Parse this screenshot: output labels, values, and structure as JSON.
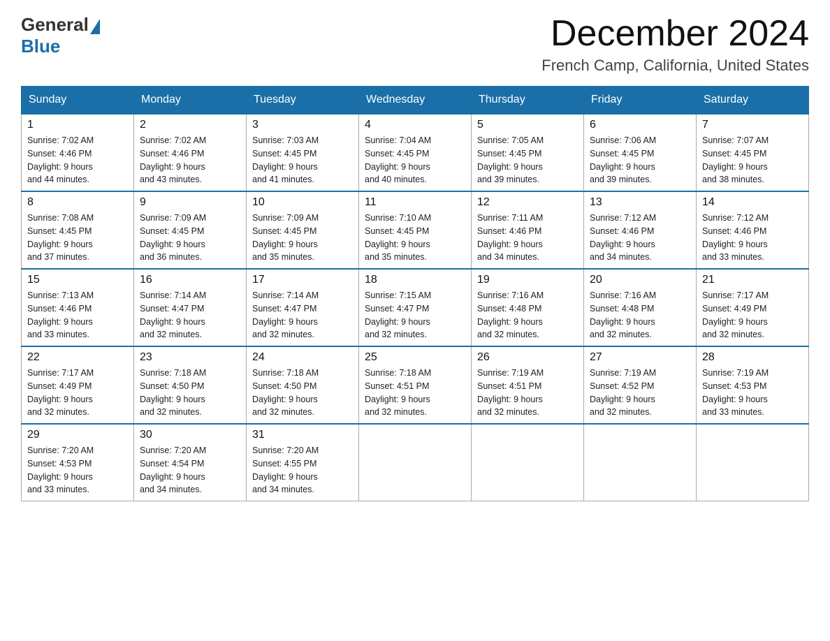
{
  "logo": {
    "general": "General",
    "blue": "Blue"
  },
  "header": {
    "month": "December 2024",
    "location": "French Camp, California, United States"
  },
  "weekdays": [
    "Sunday",
    "Monday",
    "Tuesday",
    "Wednesday",
    "Thursday",
    "Friday",
    "Saturday"
  ],
  "weeks": [
    [
      {
        "day": "1",
        "sunrise": "7:02 AM",
        "sunset": "4:46 PM",
        "daylight": "9 hours and 44 minutes."
      },
      {
        "day": "2",
        "sunrise": "7:02 AM",
        "sunset": "4:46 PM",
        "daylight": "9 hours and 43 minutes."
      },
      {
        "day": "3",
        "sunrise": "7:03 AM",
        "sunset": "4:45 PM",
        "daylight": "9 hours and 41 minutes."
      },
      {
        "day": "4",
        "sunrise": "7:04 AM",
        "sunset": "4:45 PM",
        "daylight": "9 hours and 40 minutes."
      },
      {
        "day": "5",
        "sunrise": "7:05 AM",
        "sunset": "4:45 PM",
        "daylight": "9 hours and 39 minutes."
      },
      {
        "day": "6",
        "sunrise": "7:06 AM",
        "sunset": "4:45 PM",
        "daylight": "9 hours and 39 minutes."
      },
      {
        "day": "7",
        "sunrise": "7:07 AM",
        "sunset": "4:45 PM",
        "daylight": "9 hours and 38 minutes."
      }
    ],
    [
      {
        "day": "8",
        "sunrise": "7:08 AM",
        "sunset": "4:45 PM",
        "daylight": "9 hours and 37 minutes."
      },
      {
        "day": "9",
        "sunrise": "7:09 AM",
        "sunset": "4:45 PM",
        "daylight": "9 hours and 36 minutes."
      },
      {
        "day": "10",
        "sunrise": "7:09 AM",
        "sunset": "4:45 PM",
        "daylight": "9 hours and 35 minutes."
      },
      {
        "day": "11",
        "sunrise": "7:10 AM",
        "sunset": "4:45 PM",
        "daylight": "9 hours and 35 minutes."
      },
      {
        "day": "12",
        "sunrise": "7:11 AM",
        "sunset": "4:46 PM",
        "daylight": "9 hours and 34 minutes."
      },
      {
        "day": "13",
        "sunrise": "7:12 AM",
        "sunset": "4:46 PM",
        "daylight": "9 hours and 34 minutes."
      },
      {
        "day": "14",
        "sunrise": "7:12 AM",
        "sunset": "4:46 PM",
        "daylight": "9 hours and 33 minutes."
      }
    ],
    [
      {
        "day": "15",
        "sunrise": "7:13 AM",
        "sunset": "4:46 PM",
        "daylight": "9 hours and 33 minutes."
      },
      {
        "day": "16",
        "sunrise": "7:14 AM",
        "sunset": "4:47 PM",
        "daylight": "9 hours and 32 minutes."
      },
      {
        "day": "17",
        "sunrise": "7:14 AM",
        "sunset": "4:47 PM",
        "daylight": "9 hours and 32 minutes."
      },
      {
        "day": "18",
        "sunrise": "7:15 AM",
        "sunset": "4:47 PM",
        "daylight": "9 hours and 32 minutes."
      },
      {
        "day": "19",
        "sunrise": "7:16 AM",
        "sunset": "4:48 PM",
        "daylight": "9 hours and 32 minutes."
      },
      {
        "day": "20",
        "sunrise": "7:16 AM",
        "sunset": "4:48 PM",
        "daylight": "9 hours and 32 minutes."
      },
      {
        "day": "21",
        "sunrise": "7:17 AM",
        "sunset": "4:49 PM",
        "daylight": "9 hours and 32 minutes."
      }
    ],
    [
      {
        "day": "22",
        "sunrise": "7:17 AM",
        "sunset": "4:49 PM",
        "daylight": "9 hours and 32 minutes."
      },
      {
        "day": "23",
        "sunrise": "7:18 AM",
        "sunset": "4:50 PM",
        "daylight": "9 hours and 32 minutes."
      },
      {
        "day": "24",
        "sunrise": "7:18 AM",
        "sunset": "4:50 PM",
        "daylight": "9 hours and 32 minutes."
      },
      {
        "day": "25",
        "sunrise": "7:18 AM",
        "sunset": "4:51 PM",
        "daylight": "9 hours and 32 minutes."
      },
      {
        "day": "26",
        "sunrise": "7:19 AM",
        "sunset": "4:51 PM",
        "daylight": "9 hours and 32 minutes."
      },
      {
        "day": "27",
        "sunrise": "7:19 AM",
        "sunset": "4:52 PM",
        "daylight": "9 hours and 32 minutes."
      },
      {
        "day": "28",
        "sunrise": "7:19 AM",
        "sunset": "4:53 PM",
        "daylight": "9 hours and 33 minutes."
      }
    ],
    [
      {
        "day": "29",
        "sunrise": "7:20 AM",
        "sunset": "4:53 PM",
        "daylight": "9 hours and 33 minutes."
      },
      {
        "day": "30",
        "sunrise": "7:20 AM",
        "sunset": "4:54 PM",
        "daylight": "9 hours and 34 minutes."
      },
      {
        "day": "31",
        "sunrise": "7:20 AM",
        "sunset": "4:55 PM",
        "daylight": "9 hours and 34 minutes."
      },
      null,
      null,
      null,
      null
    ]
  ],
  "labels": {
    "sunrise": "Sunrise:",
    "sunset": "Sunset:",
    "daylight": "Daylight:"
  }
}
